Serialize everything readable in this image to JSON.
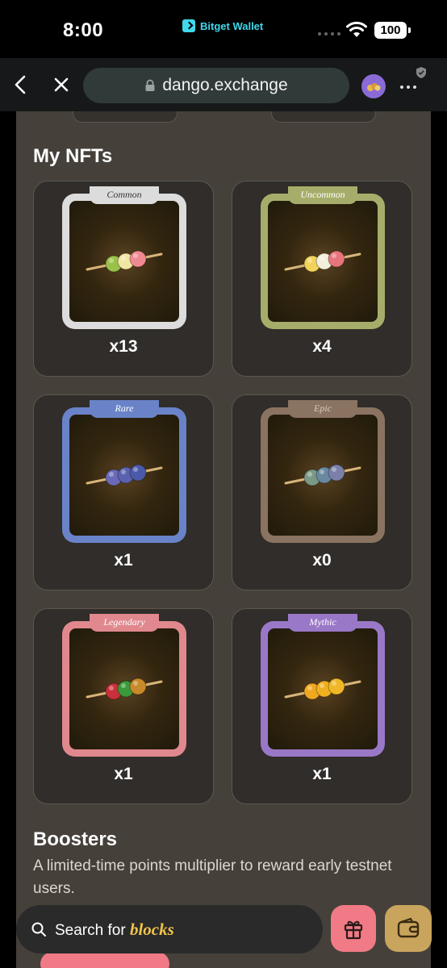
{
  "status_bar": {
    "time": "8:00",
    "wallet_name": "Bitget Wallet",
    "battery": "100"
  },
  "browser": {
    "url": "dango.exchange"
  },
  "nfts": {
    "title": "My NFTs",
    "items": [
      {
        "rarity": "Common",
        "count": "x13",
        "frame_color": "#dcdcdc",
        "tag_text_color": "#3a3a3a",
        "balls": [
          "#9ac24a",
          "#f2e6a4",
          "#f08a92"
        ]
      },
      {
        "rarity": "Uncommon",
        "count": "x4",
        "frame_color": "#a6ad6a",
        "tag_text_color": "#ffffff",
        "balls": [
          "#f2d35a",
          "#f2efdc",
          "#e8757c"
        ]
      },
      {
        "rarity": "Rare",
        "count": "x1",
        "frame_color": "#6a83c8",
        "tag_text_color": "#ffffff",
        "balls": [
          "#6a6ab8",
          "#5a62b0",
          "#4a5aa8"
        ]
      },
      {
        "rarity": "Epic",
        "count": "x0",
        "frame_color": "#8a7360",
        "tag_text_color": "#d8ccc0",
        "balls": [
          "#7a9a86",
          "#6a88a0",
          "#7a80a8"
        ]
      },
      {
        "rarity": "Legendary",
        "count": "x1",
        "frame_color": "#e0888e",
        "tag_text_color": "#ffffff",
        "balls": [
          "#c8303a",
          "#3a9a3a",
          "#c88a2a"
        ]
      },
      {
        "rarity": "Mythic",
        "count": "x1",
        "frame_color": "#9a78c8",
        "tag_text_color": "#ffffff",
        "balls": [
          "#f0a820",
          "#f0b020",
          "#f0b828"
        ]
      }
    ]
  },
  "boosters": {
    "title": "Boosters",
    "description": "A limited-time points multiplier to reward early testnet users."
  },
  "bottom_bar": {
    "search_prefix": "Search for",
    "search_emphasis": "blocks",
    "accent_search": "#f0c34a",
    "gift_color": "#f07a85",
    "wallet_color": "#c9a45d"
  }
}
